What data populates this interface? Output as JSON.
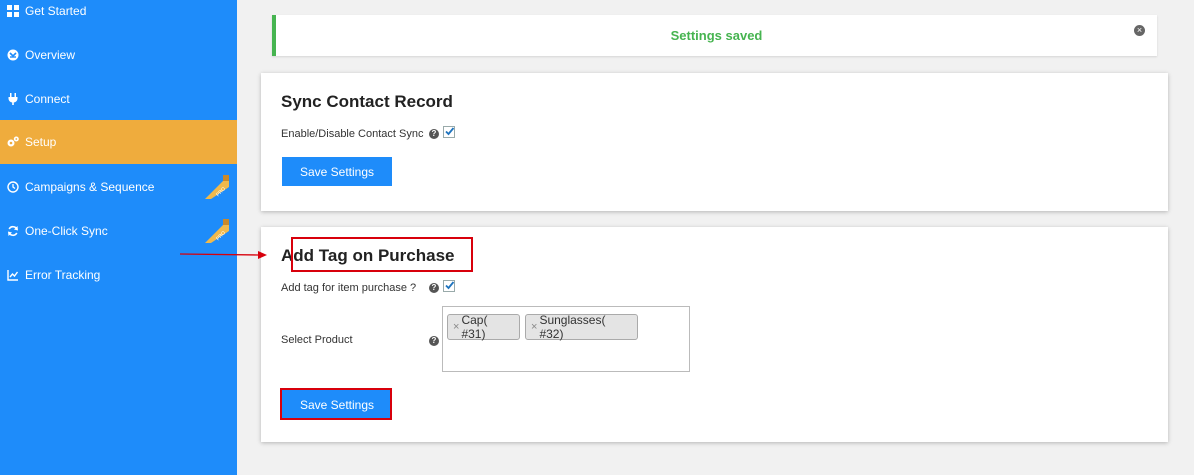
{
  "sidebar": {
    "items": [
      {
        "label": "Get Started",
        "icon": "grid-icon"
      },
      {
        "label": "Overview",
        "icon": "dashboard-icon"
      },
      {
        "label": "Connect",
        "icon": "plug-icon"
      },
      {
        "label": "Setup",
        "icon": "gears-icon"
      },
      {
        "label": "Campaigns & Sequence",
        "icon": "clock-icon"
      },
      {
        "label": "One-Click Sync",
        "icon": "refresh-icon"
      },
      {
        "label": "Error Tracking",
        "icon": "line-chart-icon"
      }
    ],
    "pro_badge": "PRO",
    "active_color": "#efac3d",
    "background": "#1e8cfa"
  },
  "notice": {
    "text": "Settings saved",
    "color": "#46b450"
  },
  "sync_card": {
    "title": "Sync Contact Record",
    "field_label": "Enable/Disable Contact Sync",
    "checked": true,
    "save_label": "Save Settings"
  },
  "tag_card": {
    "title": "Add Tag on Purchase",
    "field_label": "Add tag for item purchase ?",
    "checked": true,
    "product_label": "Select Product",
    "products": [
      "Cap( #31)",
      "Sunglasses( #32)"
    ],
    "remove_glyph": "×",
    "save_label": "Save Settings"
  },
  "help_glyph": "?"
}
